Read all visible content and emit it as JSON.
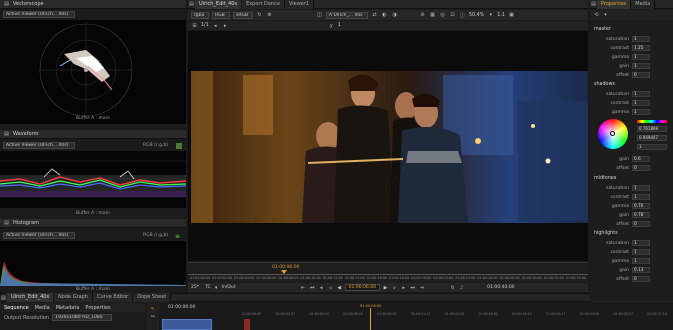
{
  "left": {
    "vectorscope": {
      "title": "Vectorscope",
      "viewer": "Active Viewer (Ulrich... 40s)",
      "buffer": "Buffer A : main"
    },
    "waveform": {
      "title": "Waveform",
      "viewer": "Active Viewer (Ulrich... 40s)",
      "mode": "RGB (r,g,b)",
      "buffer": "Buffer A : main"
    },
    "histogram": {
      "title": "Histogram",
      "viewer": "Active Viewer (Ulrich... 40s)",
      "mode": "RGB (r,g,b)",
      "buffer": "Buffer A : main"
    }
  },
  "top_tabs": [
    "Ulrich_Edit_40s",
    "Export Dance",
    "Viewer1"
  ],
  "viewer_toolbar": {
    "channels": "rgba",
    "colorspace": "RGB",
    "display": "sRGB",
    "input": "A  Ulrich_... 40s",
    "zoom": "50.4%",
    "ratio": "1:1",
    "frame": "1/1",
    "y_value": "1"
  },
  "timeline": {
    "current_marker": "01:00:06:00",
    "ticks": [
      "01:00:00:00",
      "01:00:02:00",
      "01:00:04:00",
      "01:00:06:00",
      "01:00:08:00",
      "01:00:10:00",
      "01:00:12:00",
      "01:00:14:00",
      "01:00:16:00",
      "01:00:18:00",
      "01:00:20:00",
      "01:00:22:00",
      "01:00:24:00",
      "01:00:26:00",
      "01:00:28:00",
      "01:00:30:00",
      "01:00:32:00",
      "01:00:34:00"
    ],
    "fps": "25*",
    "tc_label": "TC",
    "inout": "In/Out",
    "timecode": "01:00:06:00",
    "end_timecode": "01:00:40:00"
  },
  "bottom": {
    "tabs": [
      "Ulrich_Edit_40s",
      "Node Graph",
      "Curve Editor",
      "Dope Sheet"
    ],
    "subtabs": [
      "Sequence",
      "Media",
      "Metadata",
      "Properties"
    ],
    "output_label": "Output Resolution",
    "output_value": "1920x1080 HD_1080",
    "seq_timecode": "01:00:06:00",
    "seq_ticks": [
      "01:00:00:00",
      "01:00:02:07",
      "01:00:04:15",
      "01:00:06:22",
      "01:00:09:05",
      "01:00:11:12",
      "01:00:13:20",
      "01:00:16:02",
      "01:00:18:10",
      "01:00:20:17",
      "01:00:23:00",
      "01:00:25:07",
      "01:00:27:15"
    ],
    "seq_marker": "01:00:06:00"
  },
  "properties": {
    "tabs": [
      "Properties",
      "Media"
    ],
    "master": {
      "title": "master",
      "rows": [
        {
          "k": "saturation",
          "v": "1"
        },
        {
          "k": "contrast",
          "v": "1.25"
        },
        {
          "k": "gamma",
          "v": "1"
        },
        {
          "k": "gain",
          "v": "1"
        },
        {
          "k": "offset",
          "v": "0"
        }
      ]
    },
    "shadows": {
      "title": "shadows",
      "rows": [
        {
          "k": "saturation",
          "v": "1"
        },
        {
          "k": "contrast",
          "v": "1"
        },
        {
          "k": "gamma",
          "v": "1"
        }
      ]
    },
    "wheel_values": [
      "0.761869",
      "0.949447",
      "1"
    ],
    "shadows_lower": [
      {
        "k": "gain",
        "v": "0.6"
      },
      {
        "k": "offset",
        "v": "0"
      }
    ],
    "midtones": {
      "title": "midtones",
      "rows": [
        {
          "k": "saturation",
          "v": "1"
        },
        {
          "k": "contrast",
          "v": "1"
        },
        {
          "k": "gamma",
          "v": "0.76"
        },
        {
          "k": "gain",
          "v": "0.78"
        },
        {
          "k": "offset",
          "v": "0"
        }
      ]
    },
    "highlights": {
      "title": "highlights",
      "rows": [
        {
          "k": "saturation",
          "v": "1"
        },
        {
          "k": "contrast",
          "v": "1"
        },
        {
          "k": "gamma",
          "v": "1"
        },
        {
          "k": "gain",
          "v": "0.13"
        },
        {
          "k": "offset",
          "v": "0"
        }
      ]
    }
  }
}
